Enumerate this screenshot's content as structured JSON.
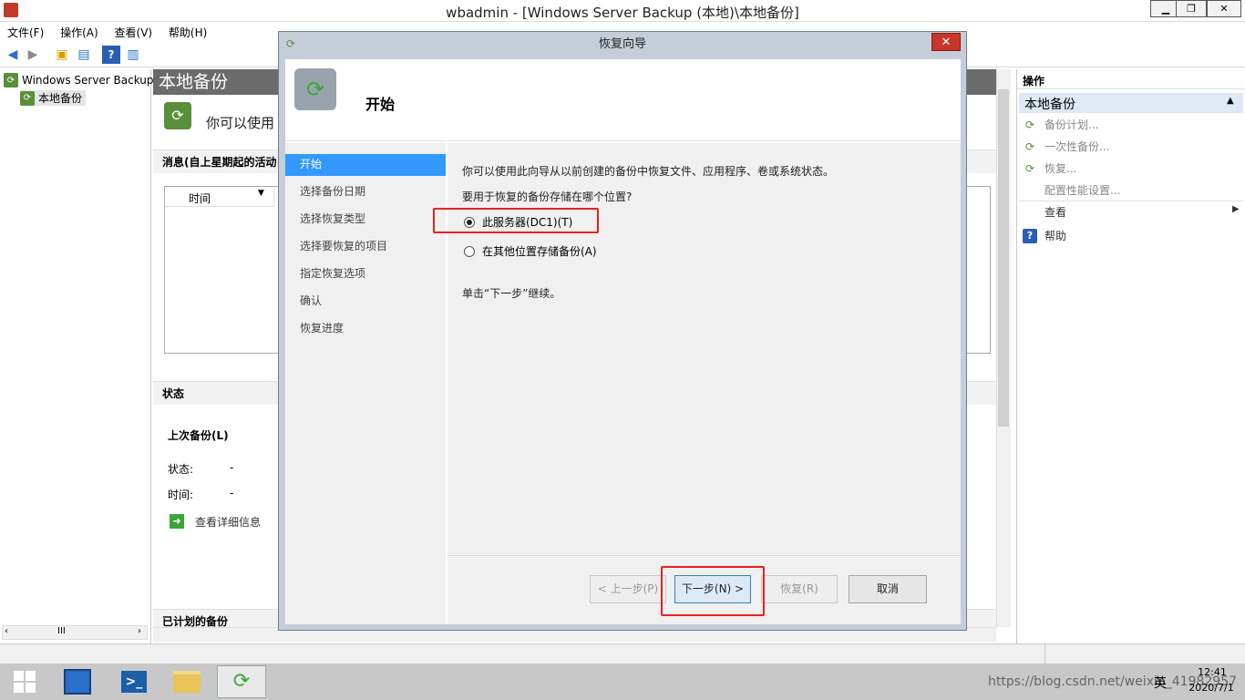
{
  "window": {
    "title": "wbadmin - [Windows Server Backup (本地)\\本地备份]",
    "minimize": "▁",
    "restore": "❐",
    "close": "✕"
  },
  "menu": [
    "文件(F)",
    "操作(A)",
    "查看(V)",
    "帮助(H)"
  ],
  "tree": {
    "root": "Windows Server Backup",
    "child": "本地备份"
  },
  "middle": {
    "header": "本地备份",
    "intro": "你可以使用",
    "messages_title": "消息(自上星期起的活动",
    "col_time": "时间",
    "status_title": "状态",
    "last_backup": "上次备份(L)",
    "status_label": "状态:",
    "status_value": "-",
    "time_label": "时间:",
    "time_value": "-",
    "view_details": "查看详细信息",
    "scheduled_title": "已计划的备份"
  },
  "actions": {
    "title": "操作",
    "group": "本地备份",
    "items": [
      "备份计划...",
      "一次性备份...",
      "恢复...",
      "配置性能设置...",
      "查看",
      "帮助"
    ]
  },
  "dialog": {
    "title": "恢复向导",
    "close": "✕",
    "heading": "开始",
    "nav": [
      "开始",
      "选择备份日期",
      "选择恢复类型",
      "选择要恢复的项目",
      "指定恢复选项",
      "确认",
      "恢复进度"
    ],
    "description": "你可以使用此向导从以前创建的备份中恢复文件、应用程序、卷或系统状态。",
    "question": "要用于恢复的备份存储在哪个位置?",
    "option_this_server": "此服务器(DC1)(T)",
    "option_other": "在其他位置存储备份(A)",
    "selected_option": "此服务器(DC1)(T)",
    "hint": "单击“下一步”继续。",
    "btn_prev": "< 上一步(P)",
    "btn_next": "下一步(N) >",
    "btn_recover": "恢复(R)",
    "btn_cancel": "取消"
  },
  "taskbar": {
    "time": "12:41",
    "date": "2020/7/1",
    "ime": "英",
    "watermark": "https://blog.csdn.net/weixin_41982957"
  },
  "colors": {
    "nav_active": "#3399ff",
    "header_bg": "#6b6b6b",
    "actions_group_bg": "#dfe8f3",
    "highlight_box": "#e6231e",
    "close_button": "#c7352b"
  }
}
